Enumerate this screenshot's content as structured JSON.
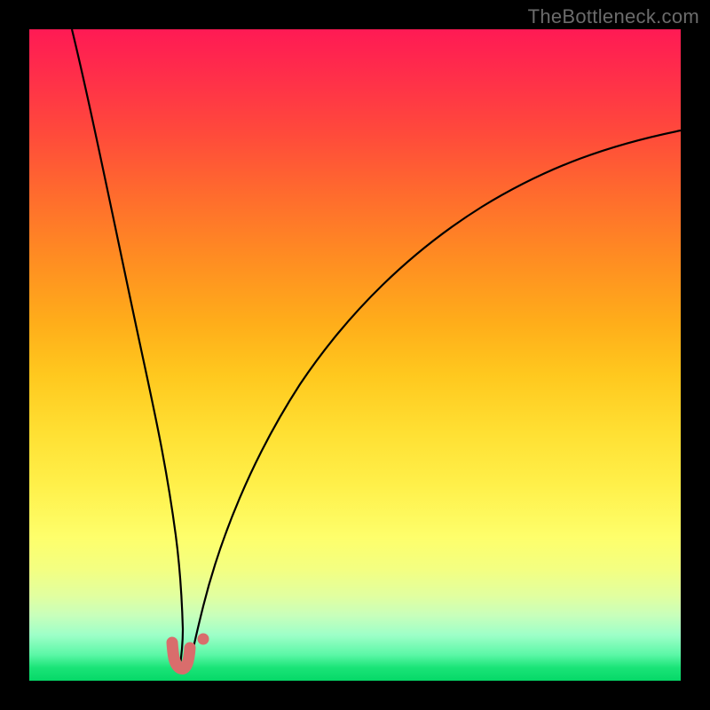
{
  "attribution": "TheBottleneck.com",
  "chart_data": {
    "type": "line",
    "title": "",
    "xlabel": "",
    "ylabel": "",
    "xlim": [
      0,
      100
    ],
    "ylim": [
      0,
      100
    ],
    "series": [
      {
        "name": "left-curve",
        "x": [
          6.5,
          8,
          10,
          12,
          14,
          16,
          17.5,
          19,
          20,
          20.8,
          21.5,
          22,
          23,
          23.8
        ],
        "y": [
          100,
          91,
          79,
          67,
          55,
          41.5,
          31,
          20,
          12,
          7,
          3.8,
          2.1,
          1.5,
          1.5
        ]
      },
      {
        "name": "right-curve",
        "x": [
          24.5,
          25.3,
          26.5,
          28,
          30,
          34,
          40,
          48,
          58,
          70,
          82,
          92,
          100
        ],
        "y": [
          1.5,
          2.1,
          5,
          11,
          19,
          32.5,
          46,
          57.5,
          67,
          74.5,
          79.5,
          82.5,
          84.5
        ]
      },
      {
        "name": "highlight-u",
        "x": [
          21.9,
          22.2,
          22.6,
          23.2,
          23.8,
          24.3,
          24.6
        ],
        "y": [
          4.3,
          2.6,
          1.7,
          1.5,
          1.7,
          2.6,
          4.3
        ]
      },
      {
        "name": "highlight-dot",
        "x": [
          26.7
        ],
        "y": [
          6.4
        ]
      }
    ],
    "gradient_stops": [
      {
        "pos": 0,
        "color": "#ff1a54"
      },
      {
        "pos": 50,
        "color": "#ffc81e"
      },
      {
        "pos": 78,
        "color": "#feff6b"
      },
      {
        "pos": 100,
        "color": "#06d868"
      }
    ],
    "highlight_color": "#d96d6c"
  }
}
